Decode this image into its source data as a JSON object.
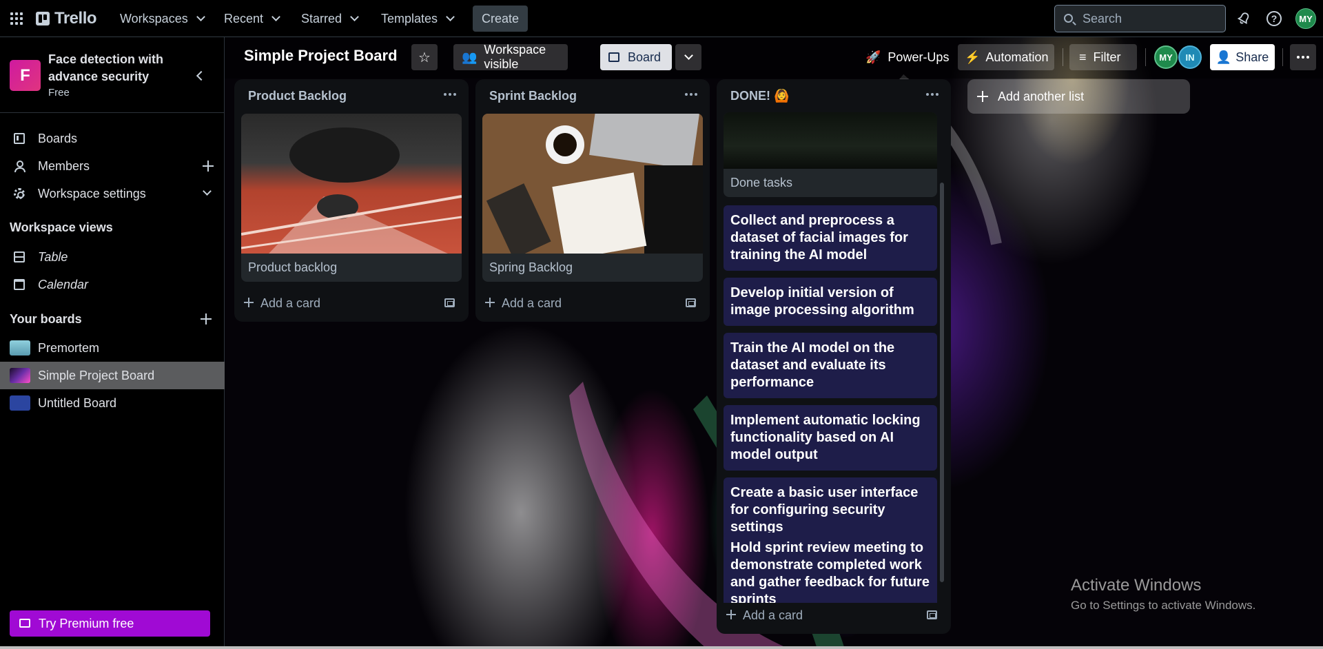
{
  "topnav": {
    "brand": "Trello",
    "menus": [
      "Workspaces",
      "Recent",
      "Starred",
      "Templates"
    ],
    "create_label": "Create",
    "search_placeholder": "Search",
    "user_initials": "MY"
  },
  "sidebar": {
    "workspace_initial": "F",
    "workspace_name": "Face detection with advance security",
    "workspace_plan": "Free",
    "items": [
      "Boards",
      "Members",
      "Workspace settings"
    ],
    "views_heading": "Workspace views",
    "views": [
      "Table",
      "Calendar"
    ],
    "boards_heading": "Your boards",
    "boards": [
      {
        "name": "Premortem",
        "color": "#6fb3c2"
      },
      {
        "name": "Simple Project Board",
        "color": "#3c1a5a"
      },
      {
        "name": "Untitled Board",
        "color": "#2b45a0"
      }
    ],
    "premium_label": "Try Premium free"
  },
  "board": {
    "title": "Simple Project Board",
    "visibility_label": "Workspace visible",
    "view_label": "Board",
    "powerups_label": "Power-Ups",
    "automation_label": "Automation",
    "filter_label": "Filter",
    "member_initials": [
      "MY",
      "IN"
    ],
    "share_label": "Share",
    "add_list_label": "Add another list"
  },
  "lists": [
    {
      "title": "Product Backlog",
      "card_title": "Product backlog",
      "add_card_label": "Add a card"
    },
    {
      "title": "Sprint Backlog",
      "card_title": "Spring Backlog",
      "add_card_label": "Add a card"
    },
    {
      "title": "DONE! 🙆",
      "cover_card_title": "Done tasks",
      "tasks": [
        "Collect and preprocess a dataset of facial images for training the AI model",
        "Develop initial version of image processing algorithm",
        "Train the AI model on the dataset and evaluate its performance",
        "Implement automatic locking functionality based on AI model output",
        "Create a basic user interface for configuring security settings",
        "Hold sprint review meeting to demonstrate completed work and gather feedback for future sprints"
      ],
      "add_card_label": "Add a card"
    }
  ],
  "watermark": {
    "title": "Activate Windows",
    "subtitle": "Go to Settings to activate Windows."
  }
}
